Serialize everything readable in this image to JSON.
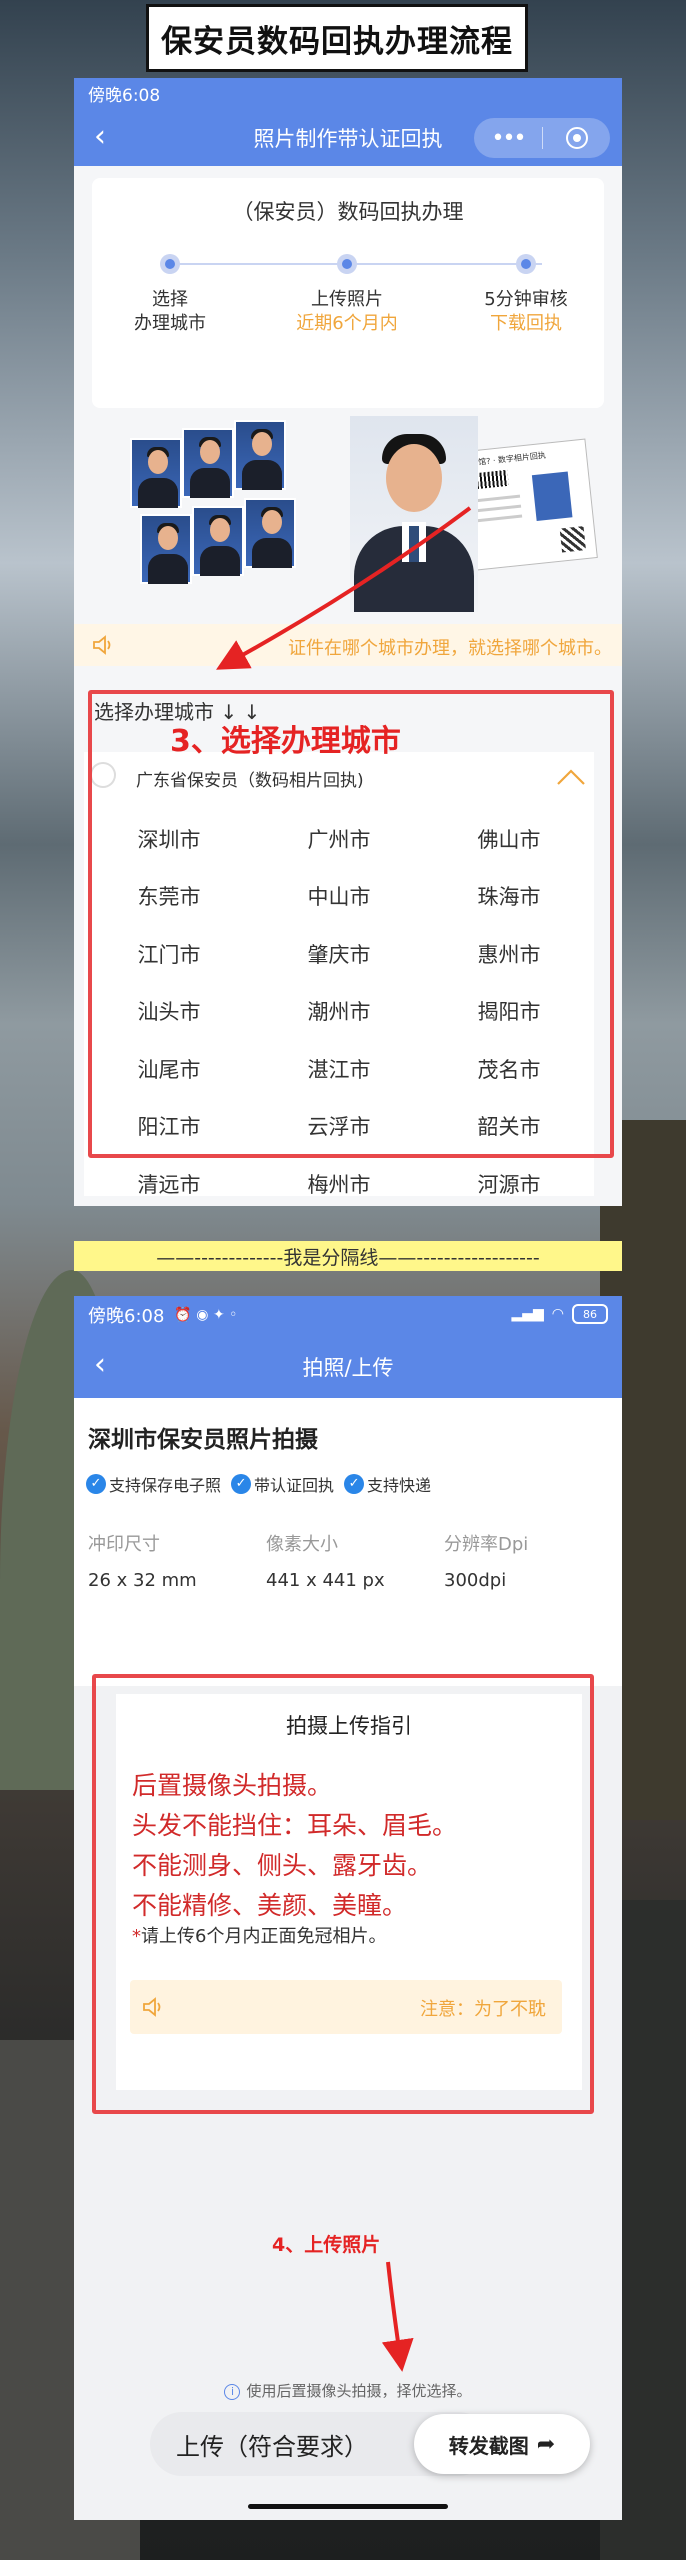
{
  "title": "保安员数码回执办理流程",
  "panel1": {
    "status_text": "傍晚6:08",
    "nav_title": "照片制作带认证回执",
    "capsule_more": "•••",
    "steps_title": "（保安员）数码回执办理",
    "steps": [
      {
        "line1": "选择",
        "line2": "办理城市"
      },
      {
        "line1": "上传照片",
        "line2": "近期6个月内"
      },
      {
        "line1": "5分钟审核",
        "line2": "下载回执"
      }
    ],
    "receipt_text": "回映照相馆? · 数字相片回执",
    "notice": "证件在哪个城市办理，就选择哪个城市。",
    "city_label": "选择办理城市 ↓ ↓",
    "province": "广东省保安员（数码相片回执)",
    "cities": [
      [
        "深圳市",
        "广州市",
        "佛山市"
      ],
      [
        "东莞市",
        "中山市",
        "珠海市"
      ],
      [
        "江门市",
        "肇庆市",
        "惠州市"
      ],
      [
        "汕头市",
        "潮州市",
        "揭阳市"
      ],
      [
        "汕尾市",
        "湛江市",
        "茂名市"
      ],
      [
        "阳江市",
        "云浮市",
        "韶关市"
      ],
      [
        "清远市",
        "梅州市",
        "河源市"
      ]
    ],
    "annotation": "3、选择办理城市"
  },
  "divider": "——-------------我是分隔线——------------------",
  "panel2": {
    "status_time": "傍晚6:08",
    "battery": "86",
    "nav_title": "拍照/上传",
    "info_title": "深圳市保安员照片拍摄",
    "tags": [
      "支持保存电子照",
      "带认证回执",
      "支持快递"
    ],
    "specs": [
      {
        "key": "冲印尺寸",
        "value": "26 x 32 mm"
      },
      {
        "key": "像素大小",
        "value": "441 x 441 px"
      },
      {
        "key": "分辨率Dpi",
        "value": "300dpi"
      }
    ],
    "guide_title": "拍摄上传指引",
    "guide_lines": [
      "后置摄像头拍摄。",
      "头发不能挡住：耳朵、眉毛。",
      "不能测身、侧头、露牙齿。",
      "不能精修、美颜、美瞳。"
    ],
    "guide_note": "请上传6个月内正面免冠相片。",
    "guide_notice": "注意：为了不耽",
    "annotation": "4、上传照片",
    "bottom_tip": "使用后置摄像头拍摄，择优选择。",
    "upload_label": "上传（符合要求）",
    "share_label": "转发截图"
  }
}
